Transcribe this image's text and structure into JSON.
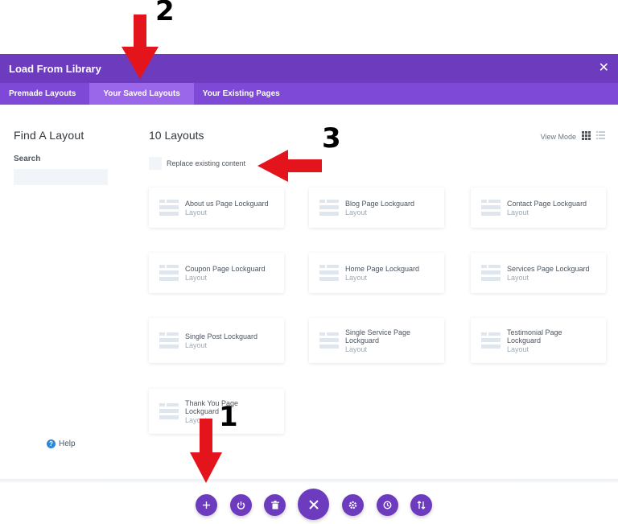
{
  "modal": {
    "title": "Load From Library",
    "close_glyph": "✕",
    "tabs": [
      {
        "label": "Premade Layouts",
        "active": false
      },
      {
        "label": "Your Saved Layouts",
        "active": true
      },
      {
        "label": "Your Existing Pages",
        "active": false
      }
    ]
  },
  "sidebar": {
    "heading": "Find A Layout",
    "search_label": "Search",
    "search_value": "",
    "help_label": "Help"
  },
  "main": {
    "heading": "10 Layouts",
    "view_mode_label": "View Mode",
    "replace_label": "Replace existing content",
    "replace_checked": false,
    "layouts": [
      {
        "name": "About us Page Lockguard",
        "type": "Layout"
      },
      {
        "name": "Blog Page Lockguard",
        "type": "Layout"
      },
      {
        "name": "Contact Page Lockguard",
        "type": "Layout"
      },
      {
        "name": "Coupon Page Lockguard",
        "type": "Layout"
      },
      {
        "name": "Home Page Lockguard",
        "type": "Layout"
      },
      {
        "name": "Services Page Lockguard",
        "type": "Layout"
      },
      {
        "name": "Single Post Lockguard",
        "type": "Layout"
      },
      {
        "name": "Single Service Page Lockguard",
        "type": "Layout"
      },
      {
        "name": "Testimonial Page Lockguard",
        "type": "Layout"
      },
      {
        "name": "Thank You Page Lockguard",
        "type": "Layout"
      }
    ]
  },
  "toolbar": {
    "buttons": [
      {
        "icon": "plus-icon"
      },
      {
        "icon": "power-icon"
      },
      {
        "icon": "trash-icon"
      },
      {
        "icon": "close-icon"
      },
      {
        "icon": "gear-icon"
      },
      {
        "icon": "history-icon"
      },
      {
        "icon": "sort-icon"
      }
    ]
  },
  "annotations": {
    "step1": "1",
    "step2": "2",
    "step3": "3"
  },
  "colors": {
    "header": "#6c3bbe",
    "tab_bar": "#7e49d6",
    "tab_active": "#9a67ea",
    "arrow": "#e3141b",
    "help_icon": "#2b87da"
  }
}
